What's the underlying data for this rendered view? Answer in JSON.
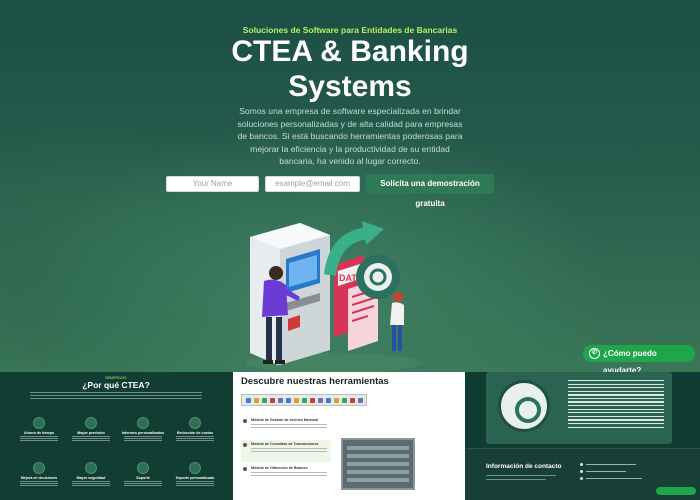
{
  "hero": {
    "kicker": "Soluciones de Software para Entidades de Bancarias",
    "title_line1": "CTEA & Banking",
    "title_line2": "Systems",
    "subtitle_lines": [
      "Somos una empresa de software especializada en brindar",
      "soluciones personalizadas y de alta calidad para empresas",
      "de bancos. Si está buscando herramientas poderosas para",
      "mejorar la eficiencia y la productividad de su entidad",
      "bancaria, ha venido al lugar correcto."
    ],
    "name_placeholder": "Your Name",
    "email_placeholder": "example@email.com",
    "cta_label": "Solicita una demostración gratuita",
    "illustration_text": "DATA"
  },
  "whatsapp": {
    "label": "¿Cómo puedo ayudarte?",
    "color": "#1fa64a"
  },
  "thumbnails": {
    "why": {
      "kicker": "BENEFICIOS",
      "title": "¿Por qué CTEA?",
      "features": [
        "Ahorro de tiempo",
        "Mayor precisión",
        "Informes personalizados",
        "Reducción de costos",
        "Mejora en decisiones",
        "Mayor seguridad",
        "Soporte",
        "Soporte personalizado"
      ]
    },
    "tools": {
      "title": "Descubre nuestras herramientas",
      "items": [
        "Módulo de Gestión de Archivo Mensual",
        "Módulo de Consultas de Transacciones",
        "Módulo de Obtención de Balance"
      ]
    },
    "about": {
      "contact_title": "Información de contacto"
    }
  },
  "colors": {
    "accent": "#b9f06a",
    "cta": "#2e7a55",
    "hero_bg": "#1c4f45"
  }
}
